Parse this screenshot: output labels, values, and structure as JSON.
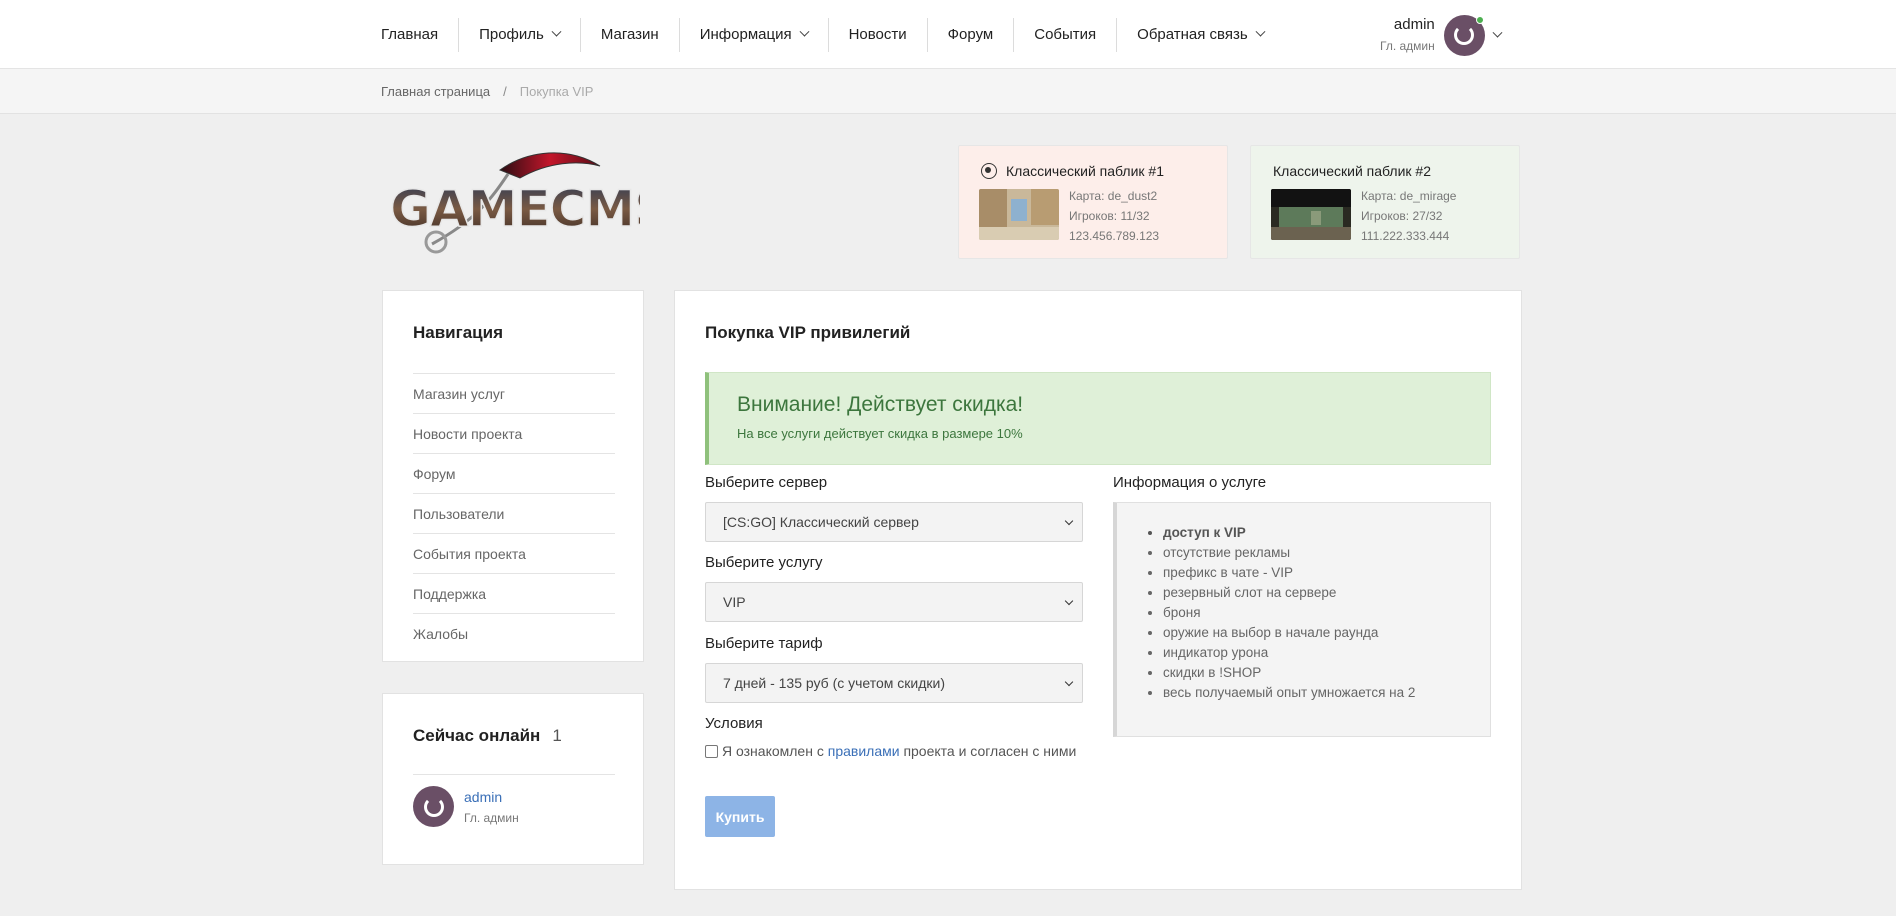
{
  "nav": {
    "items": [
      {
        "label": "Главная",
        "dropdown": false
      },
      {
        "label": "Профиль",
        "dropdown": true
      },
      {
        "label": "Магазин",
        "dropdown": false
      },
      {
        "label": "Информация",
        "dropdown": true
      },
      {
        "label": "Новости",
        "dropdown": false
      },
      {
        "label": "Форум",
        "dropdown": false
      },
      {
        "label": "События",
        "dropdown": false
      },
      {
        "label": "Обратная связь",
        "dropdown": true
      }
    ]
  },
  "user": {
    "name": "admin",
    "role": "Гл. админ",
    "avatar_color": "#6a4f66",
    "status_color": "#4caf50"
  },
  "breadcrumb": {
    "home": "Главная страница",
    "separator": "/",
    "current": "Покупка VIP"
  },
  "logo": {
    "text": "GAMECMS"
  },
  "servers": [
    {
      "title": "Классический паблик #1",
      "map": "Карта: de_dust2",
      "players": "Игроков: 11/32",
      "ip": "123.456.789.123",
      "bg": "#fdeeea",
      "icon": "steam-icon"
    },
    {
      "title": "Классический паблик #2",
      "map": "Карта: de_mirage",
      "players": "Игроков: 27/32",
      "ip": "111.222.333.444",
      "bg": "#eef4ec"
    }
  ],
  "sidebar": {
    "title": "Навигация",
    "items": [
      "Магазин услуг",
      "Новости проекта",
      "Форум",
      "Пользователи",
      "События проекта",
      "Поддержка",
      "Жалобы"
    ]
  },
  "online": {
    "title": "Сейчас онлайн",
    "count": "1",
    "users": [
      {
        "name": "admin",
        "role": "Гл. админ"
      }
    ]
  },
  "main": {
    "title": "Покупка VIP привилегий",
    "alert": {
      "heading": "Внимание! Действует скидка!",
      "text": "На все услуги действует скидка в размере 10%"
    },
    "server_label": "Выберите сервер",
    "server_value": "[CS:GO] Классический сервер",
    "service_label": "Выберите услугу",
    "service_value": "VIP",
    "tariff_label": "Выберите тариф",
    "tariff_value": "7 дней - 135 руб (с учетом скидки)",
    "conditions_label": "Условия",
    "agree_prefix": "Я ознакомлен с",
    "agree_link": "правилами",
    "agree_suffix": "проекта и согласен с ними",
    "agree_checked": false,
    "buy_label": "Купить",
    "info_label": "Информация о услуге",
    "info_items": [
      "доступ к VIP",
      "отсутствие рекламы",
      "префикс в чате - VIP",
      "резервный слот на сервере",
      "броня",
      "оружие на выбор в начале раунда",
      "индикатор урона",
      "скидки в !SHOP",
      "весь получаемый опыт умножается на 2"
    ]
  },
  "colors": {
    "accent": "#3a6fb7",
    "button_disabled": "#8db4e6",
    "alert_bg": "#dff0d8",
    "alert_text": "#3c763d"
  }
}
